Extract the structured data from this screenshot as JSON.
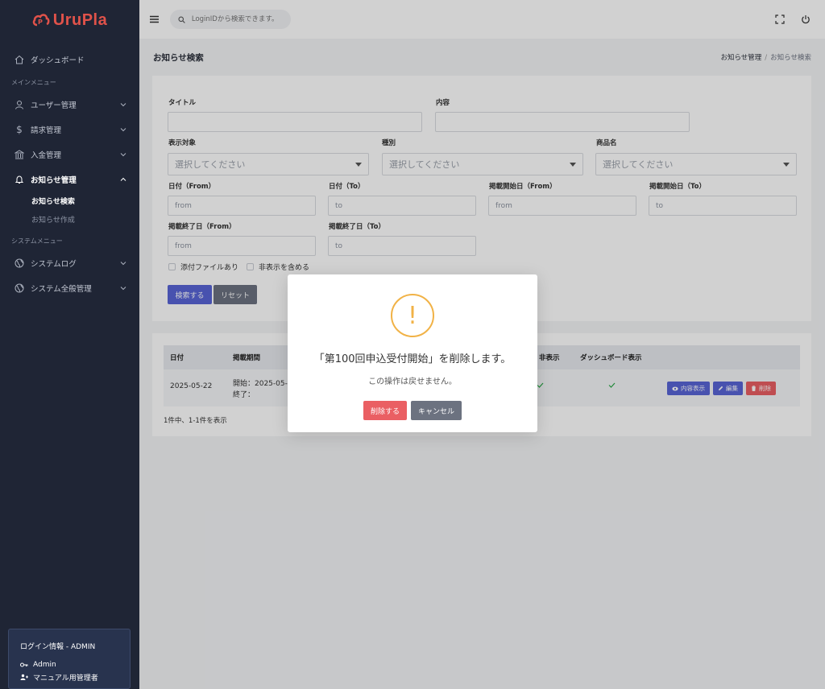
{
  "brand": {
    "name": "UruPla",
    "color": "#e0524a"
  },
  "sidebar": {
    "dashboard": "ダッシュボード",
    "section_main": "メインメニュー",
    "items_main": [
      {
        "label": "ユーザー管理",
        "icon": "user-icon"
      },
      {
        "label": "請求管理",
        "icon": "dollar-icon"
      },
      {
        "label": "入金管理",
        "icon": "bank-icon"
      },
      {
        "label": "お知らせ管理",
        "icon": "bell-icon"
      }
    ],
    "subitems": [
      "お知らせ検索",
      "お知らせ作成"
    ],
    "section_system": "システムメニュー",
    "items_system": [
      {
        "label": "システムログ",
        "icon": "globe-icon"
      },
      {
        "label": "システム全般管理",
        "icon": "globe-icon"
      }
    ],
    "login": {
      "title": "ログイン情報 - ADMIN",
      "user": "Admin",
      "role": "マニュアル用管理者"
    }
  },
  "topbar": {
    "search_placeholder": "LoginIDから検索できます。"
  },
  "page": {
    "title": "お知らせ検索",
    "breadcrumb": [
      "お知らせ管理",
      "お知らせ検索"
    ]
  },
  "form": {
    "title_label": "タイトル",
    "content_label": "内容",
    "target_label": "表示対象",
    "type_label": "種別",
    "product_label": "商品名",
    "select_placeholder": "選択してください",
    "date_from_label": "日付（From）",
    "date_to_label": "日付（To）",
    "pub_start_from_label": "掲載開始日（From）",
    "pub_start_to_label": "掲載開始日（To）",
    "pub_end_from_label": "掲載終了日（From）",
    "pub_end_to_label": "掲載終了日（To）",
    "from": "from",
    "to": "to",
    "attach_label": "添付ファイルあり",
    "hidden_label": "非表示を含める",
    "search_button": "検索する",
    "reset_button": "リセット"
  },
  "table": {
    "headers": [
      "日付",
      "掲載期間",
      "非表示",
      "ダッシュボード表示"
    ],
    "rows": [
      {
        "date": "2025-05-22",
        "period_start": "開始：2025-05-",
        "period_end": "終了："
      }
    ],
    "actions": {
      "view": "内容表示",
      "edit": "編集",
      "delete": "削除"
    },
    "summary": "1件中、1-1件を表示"
  },
  "modal": {
    "icon": "!",
    "title": "「第100回申込受付開始」を削除します。",
    "text": "この操作は戻せません。",
    "confirm": "削除する",
    "cancel": "キャンセル"
  },
  "colors": {
    "primary": "#5865d6",
    "secondary": "#6c7280",
    "danger": "#ea5f63",
    "warning": "#f1b246",
    "sidebar": "#1f2535"
  }
}
